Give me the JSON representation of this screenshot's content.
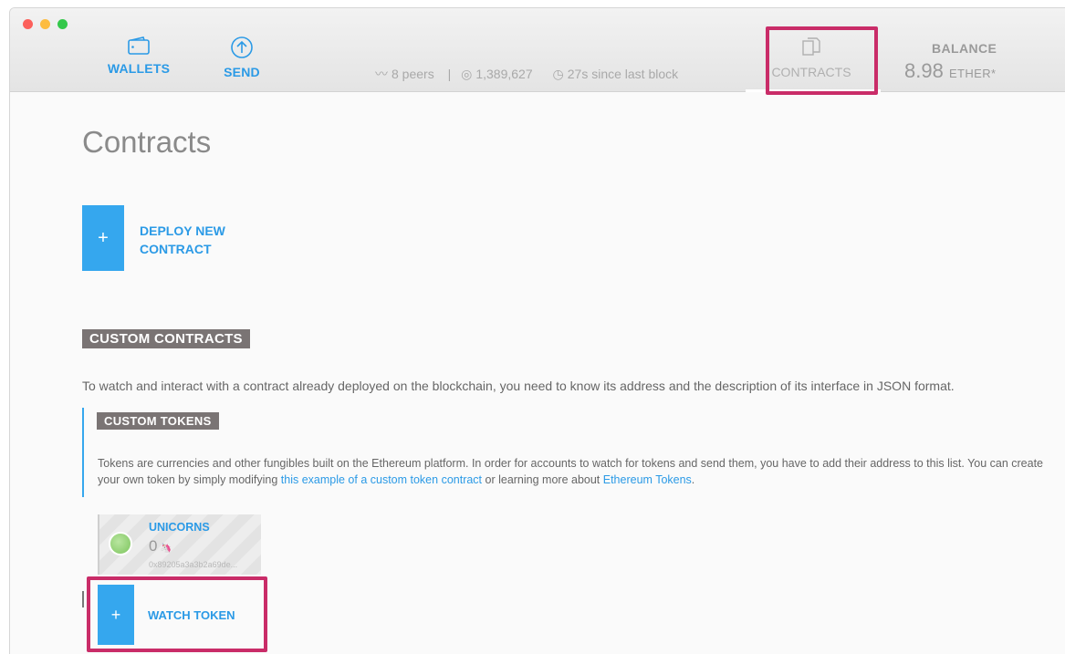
{
  "nav": {
    "wallets_label": "WALLETS",
    "send_label": "SEND",
    "contracts_label": "CONTRACTS",
    "icons": {
      "wallets": "wallet-icon",
      "send": "send-arrow-icon",
      "contracts": "documents-icon"
    }
  },
  "status": {
    "peers": "8 peers",
    "blocks": "1,389,627",
    "last_block": "27s since last block",
    "icons": {
      "peers": "signal-icon",
      "blocks": "block-icon",
      "time": "clock-icon"
    }
  },
  "balance": {
    "label": "BALANCE",
    "value": "8.98",
    "unit": "ETHER*"
  },
  "page": {
    "title": "Contracts",
    "deploy_plus": "+",
    "deploy_label": "DEPLOY NEW CONTRACT",
    "custom_contracts_heading": "CUSTOM CONTRACTS",
    "custom_contracts_desc": "To watch and interact with a contract already deployed on the blockchain, you need to know its address and the description of its interface in JSON format.",
    "custom_tokens_heading": "CUSTOM TOKENS",
    "tokens_desc_1": "Tokens are currencies and other fungibles built on the Ethereum platform. In order for accounts to watch for tokens and send them, you have to add their address to this list. You can create your own token by simply modifying ",
    "tokens_link_1": "this example of a custom token contract",
    "tokens_desc_2": " or learning more about ",
    "tokens_link_2": "Ethereum Tokens",
    "tokens_desc_3": ".",
    "watch_plus": "+",
    "watch_label": "WATCH TOKEN"
  },
  "tokens": [
    {
      "name": "UNICORNS",
      "balance": "0",
      "symbol": "🦄",
      "address": "0x89205a3a3b2a69de..."
    }
  ],
  "colors": {
    "accent": "#35a7ee",
    "highlight": "#c92c68",
    "section_head": "#7a7474"
  }
}
